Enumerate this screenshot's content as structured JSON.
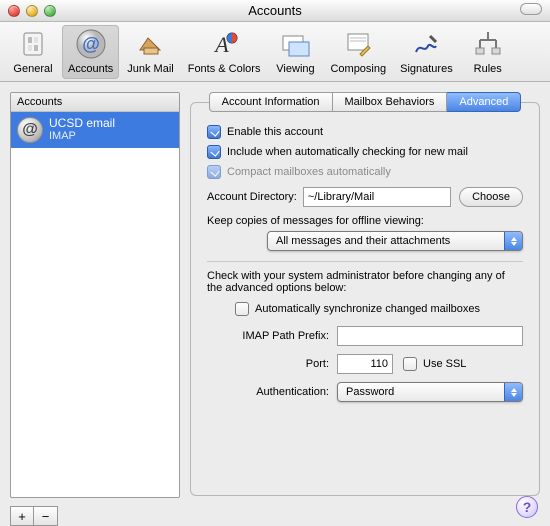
{
  "window": {
    "title": "Accounts"
  },
  "toolbar": {
    "items": [
      {
        "label": "General"
      },
      {
        "label": "Accounts"
      },
      {
        "label": "Junk Mail"
      },
      {
        "label": "Fonts & Colors"
      },
      {
        "label": "Viewing"
      },
      {
        "label": "Composing"
      },
      {
        "label": "Signatures"
      },
      {
        "label": "Rules"
      }
    ]
  },
  "sidebar": {
    "header": "Accounts",
    "account": {
      "name": "UCSD email",
      "type": "IMAP"
    }
  },
  "tabs": {
    "info": "Account Information",
    "mailbox": "Mailbox Behaviors",
    "advanced": "Advanced"
  },
  "advanced": {
    "enable": "Enable this account",
    "include": "Include when automatically checking for new mail",
    "compact": "Compact mailboxes automatically",
    "acct_dir_label": "Account Directory:",
    "acct_dir_value": "~/Library/Mail",
    "choose": "Choose",
    "keep_copies": "Keep copies of messages for offline viewing:",
    "keep_copies_value": "All messages and their attachments",
    "admin_note": "Check with your system administrator before changing any of the advanced options below:",
    "auto_sync": "Automatically synchronize changed mailboxes",
    "imap_prefix_label": "IMAP Path Prefix:",
    "imap_prefix_value": "",
    "port_label": "Port:",
    "port_value": "110",
    "use_ssl": "Use SSL",
    "auth_label": "Authentication:",
    "auth_value": "Password"
  }
}
